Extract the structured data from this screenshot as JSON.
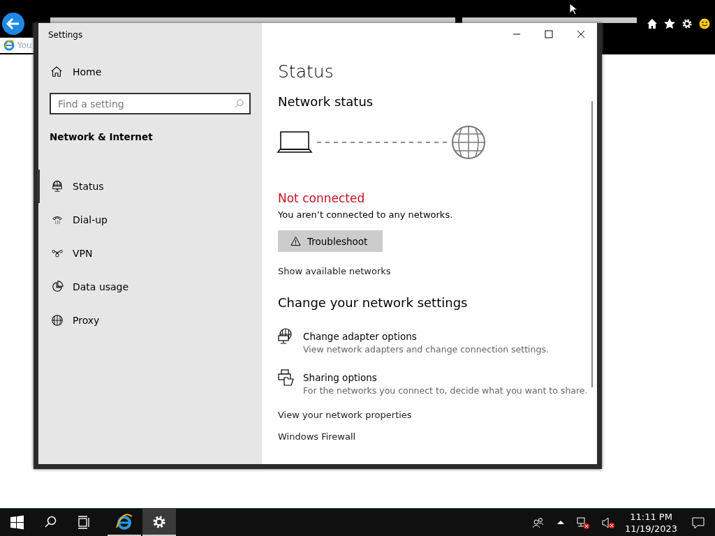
{
  "browser": {
    "tab_title": "You"
  },
  "settings_window": {
    "title": "Settings"
  },
  "sidebar": {
    "home": "Home",
    "search": {
      "placeholder": "Find a setting"
    },
    "section": "Network & Internet",
    "items": [
      {
        "label": "Status",
        "kind": "status",
        "selected": true
      },
      {
        "label": "Dial-up",
        "kind": "dialup",
        "selected": false
      },
      {
        "label": "VPN",
        "kind": "vpn",
        "selected": false
      },
      {
        "label": "Data usage",
        "kind": "data",
        "selected": false
      },
      {
        "label": "Proxy",
        "kind": "proxy",
        "selected": false
      }
    ]
  },
  "content": {
    "title": "Status",
    "network_status": "Network status",
    "connected": false,
    "status_text": "Not connected",
    "status_detail": "You aren’t connected to any networks.",
    "troubleshoot": "Troubleshoot",
    "show_networks": "Show available networks",
    "change_heading": "Change your network settings",
    "options": [
      {
        "kind": "adapter",
        "title": "Change adapter options",
        "description": "View network adapters and change connection settings."
      },
      {
        "kind": "sharing",
        "title": "Sharing options",
        "description": "For the networks you connect to, decide what you want to share."
      }
    ],
    "links": [
      "View your network properties",
      "Windows Firewall"
    ]
  },
  "taskbar": {
    "apps": [
      {
        "kind": "ie",
        "selected": false
      },
      {
        "kind": "settings",
        "selected": true
      }
    ],
    "time": "11:11 PM",
    "date": "11/19/2023"
  }
}
